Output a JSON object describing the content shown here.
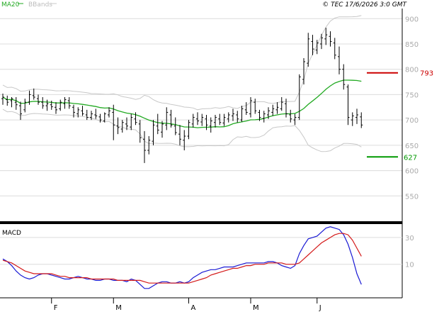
{
  "header": {
    "legend_ma": "MA20",
    "legend_bb": "BBands",
    "copyright": "© TEC 17/6/2026 3:0 GMT"
  },
  "colors": {
    "price": "#000000",
    "ma20": "#22aa22",
    "bbands": "#c8c8c8",
    "resistance": "#cc0000",
    "support": "#009900",
    "macd": "#1a1ad4",
    "signal": "#d41a1a",
    "grid": "#dcdcdc",
    "tick_label": "#aaaaaa"
  },
  "chart_data": [
    {
      "type": "ohlc",
      "panel": "price",
      "ylim": [
        500,
        920
      ],
      "y_ticks": [
        550,
        600,
        650,
        700,
        750,
        800,
        850,
        900
      ],
      "x_labels": [
        "F",
        "M",
        "A",
        "M",
        "J"
      ],
      "x_label_bars": [
        11,
        25,
        42,
        56,
        71
      ],
      "levels": [
        {
          "name": "resistance",
          "value": 793,
          "label": "793"
        },
        {
          "name": "support",
          "value": 627,
          "label": "627"
        }
      ],
      "bars": [
        [
          742,
          752,
          730,
          745
        ],
        [
          740,
          748,
          728,
          735
        ],
        [
          738,
          745,
          725,
          742
        ],
        [
          735,
          745,
          720,
          730
        ],
        [
          728,
          736,
          700,
          712
        ],
        [
          720,
          742,
          715,
          735
        ],
        [
          735,
          758,
          730,
          750
        ],
        [
          748,
          762,
          740,
          745
        ],
        [
          742,
          750,
          730,
          735
        ],
        [
          735,
          745,
          722,
          728
        ],
        [
          728,
          740,
          718,
          732
        ],
        [
          730,
          738,
          720,
          726
        ],
        [
          725,
          735,
          712,
          720
        ],
        [
          722,
          740,
          718,
          735
        ],
        [
          732,
          745,
          722,
          740
        ],
        [
          738,
          745,
          722,
          728
        ],
        [
          725,
          730,
          705,
          715
        ],
        [
          712,
          725,
          705,
          720
        ],
        [
          718,
          728,
          708,
          712
        ],
        [
          710,
          720,
          700,
          705
        ],
        [
          705,
          718,
          700,
          712
        ],
        [
          710,
          722,
          702,
          708
        ],
        [
          706,
          712,
          695,
          700
        ],
        [
          698,
          715,
          695,
          712
        ],
        [
          710,
          725,
          705,
          718
        ],
        [
          715,
          730,
          660,
          690
        ],
        [
          688,
          705,
          672,
          685
        ],
        [
          682,
          700,
          675,
          695
        ],
        [
          692,
          705,
          680,
          688
        ],
        [
          686,
          712,
          680,
          705
        ],
        [
          702,
          715,
          690,
          695
        ],
        [
          692,
          700,
          655,
          665
        ],
        [
          662,
          678,
          615,
          640
        ],
        [
          640,
          668,
          632,
          660
        ],
        [
          658,
          700,
          650,
          690
        ],
        [
          688,
          712,
          672,
          680
        ],
        [
          676,
          698,
          665,
          692
        ],
        [
          690,
          725,
          680,
          715
        ],
        [
          710,
          720,
          685,
          690
        ],
        [
          688,
          705,
          670,
          675
        ],
        [
          672,
          690,
          650,
          662
        ],
        [
          660,
          680,
          640,
          668
        ],
        [
          668,
          700,
          662,
          695
        ],
        [
          692,
          712,
          685,
          705
        ],
        [
          702,
          715,
          690,
          698
        ],
        [
          696,
          712,
          688,
          705
        ],
        [
          702,
          710,
          680,
          690
        ],
        [
          688,
          705,
          675,
          698
        ],
        [
          695,
          710,
          685,
          705
        ],
        [
          702,
          712,
          690,
          695
        ],
        [
          694,
          712,
          688,
          705
        ],
        [
          702,
          715,
          695,
          710
        ],
        [
          708,
          722,
          698,
          712
        ],
        [
          710,
          718,
          695,
          702
        ],
        [
          700,
          728,
          696,
          722
        ],
        [
          720,
          735,
          710,
          715
        ],
        [
          712,
          745,
          705,
          738
        ],
        [
          735,
          742,
          712,
          718
        ],
        [
          715,
          720,
          698,
          705
        ],
        [
          703,
          718,
          695,
          712
        ],
        [
          710,
          725,
          702,
          718
        ],
        [
          715,
          730,
          708,
          722
        ],
        [
          720,
          735,
          712,
          725
        ],
        [
          722,
          745,
          718,
          735
        ],
        [
          732,
          742,
          705,
          712
        ],
        [
          710,
          720,
          695,
          702
        ],
        [
          700,
          712,
          690,
          705
        ],
        [
          705,
          790,
          700,
          785
        ],
        [
          780,
          822,
          770,
          815
        ],
        [
          812,
          872,
          805,
          860
        ],
        [
          855,
          868,
          828,
          840
        ],
        [
          838,
          858,
          830,
          852
        ],
        [
          850,
          870,
          840,
          862
        ],
        [
          860,
          882,
          848,
          868
        ],
        [
          865,
          875,
          845,
          855
        ],
        [
          852,
          862,
          820,
          828
        ],
        [
          825,
          845,
          790,
          800
        ],
        [
          800,
          810,
          760,
          770
        ],
        [
          765,
          770,
          690,
          705
        ],
        [
          700,
          715,
          688,
          708
        ],
        [
          705,
          722,
          692,
          710
        ],
        [
          706,
          715,
          684,
          690
        ]
      ]
    },
    {
      "type": "line",
      "panel": "macd",
      "ylim": [
        -15,
        40
      ],
      "y_ticks": [
        10,
        30
      ],
      "title": "MACD",
      "series": [
        {
          "name": "macd",
          "values": [
            14,
            12,
            9,
            5,
            2,
            0,
            -1,
            0,
            2,
            3,
            3,
            2,
            1,
            0,
            -1,
            -1,
            0,
            1,
            0,
            -1,
            -1,
            -2,
            -2,
            -1,
            -1,
            -2,
            -2,
            -2,
            -3,
            -1,
            -2,
            -5,
            -8,
            -8,
            -6,
            -4,
            -3,
            -3,
            -4,
            -4,
            -3,
            -4,
            -3,
            0,
            2,
            4,
            5,
            6,
            6,
            7,
            8,
            8,
            8,
            9,
            10,
            11,
            11,
            11,
            11,
            11,
            12,
            12,
            11,
            9,
            8,
            7,
            9,
            18,
            24,
            29,
            30,
            31,
            34,
            37,
            38,
            37,
            36,
            32,
            25,
            15,
            3,
            -5
          ]
        },
        {
          "name": "signal",
          "values": [
            13,
            12,
            11,
            9,
            7,
            5,
            4,
            3,
            3,
            3,
            3,
            3,
            2,
            1,
            1,
            0,
            0,
            0,
            0,
            0,
            -1,
            -1,
            -1,
            -1,
            -1,
            -1,
            -2,
            -2,
            -2,
            -2,
            -2,
            -2,
            -3,
            -4,
            -4,
            -4,
            -4,
            -4,
            -4,
            -4,
            -4,
            -4,
            -4,
            -3,
            -2,
            -1,
            0,
            2,
            3,
            4,
            5,
            6,
            7,
            7,
            8,
            9,
            9,
            10,
            10,
            10,
            11,
            11,
            11,
            11,
            10,
            10,
            10,
            11,
            14,
            17,
            20,
            23,
            26,
            28,
            30,
            32,
            33,
            33,
            32,
            28,
            22,
            16
          ]
        }
      ]
    }
  ]
}
